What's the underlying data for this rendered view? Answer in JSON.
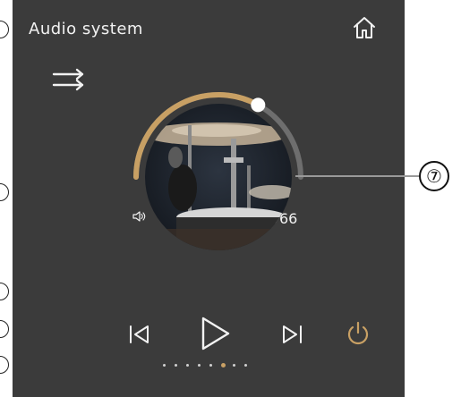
{
  "header": {
    "title": "Audio system"
  },
  "icons": {
    "home": "home-icon",
    "shuffle": "shuffle-icon",
    "speaker": "speaker-icon",
    "previous": "skip-previous-icon",
    "play": "play-icon",
    "next": "skip-next-icon",
    "power": "power-icon"
  },
  "volume": {
    "value": "66",
    "level": 0.66
  },
  "pager": {
    "count": 8,
    "active_index": 5
  },
  "annotation": {
    "label": "⑦"
  },
  "colors": {
    "panel": "#3b3b3b",
    "accent": "#c8a064",
    "track": "#6e6e6e",
    "text": "#f2f2f2"
  }
}
